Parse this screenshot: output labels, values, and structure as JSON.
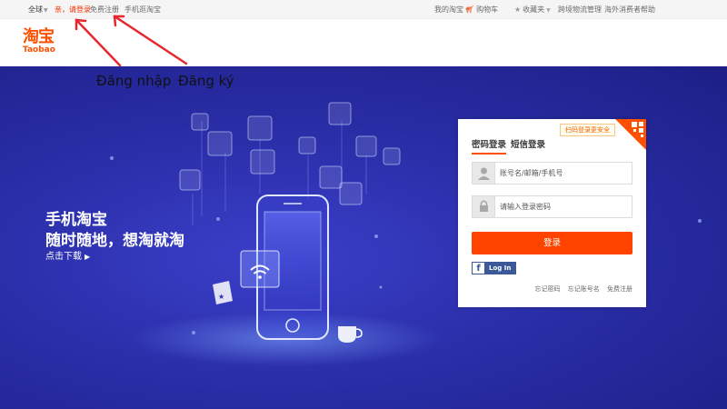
{
  "topbar": {
    "region": "全球",
    "login": "亲，请登录",
    "register": "免费注册",
    "mobile": "手机逛淘宝",
    "my_taobao": "我的淘宝",
    "cart": "购物车",
    "favorites": "收藏夹",
    "cross_border": "跨境物流管理",
    "help": "海外消费者帮助"
  },
  "logo": {
    "cn": "淘宝",
    "en": "Taobao"
  },
  "annotations": {
    "login": "Đăng nhập",
    "register": "Đăng ký",
    "arrow_color": "#e8262e"
  },
  "hero": {
    "title": "手机淘宝",
    "subtitle": "随时随地，想淘就淘",
    "download": "点击下载"
  },
  "login_box": {
    "tab_password": "密码登录",
    "tab_sms": "短信登录",
    "qr_tip": "扫码登录更安全",
    "username_placeholder": "账号名/邮箱/手机号",
    "password_placeholder": "请输入登录密码",
    "submit": "登录",
    "facebook": "Log In",
    "forgot_password": "忘记密码",
    "forgot_account": "忘记账号名",
    "free_register": "免费注册"
  },
  "colors": {
    "brand": "#ff5000",
    "login_button": "#ff4400",
    "hero_bg": "#2a2ea8",
    "facebook": "#3b5998"
  },
  "icons": [
    "user-icon",
    "lock-icon",
    "facebook-icon",
    "qr-code-icon",
    "cart-icon",
    "star-icon",
    "play-icon",
    "wifi-icon"
  ]
}
